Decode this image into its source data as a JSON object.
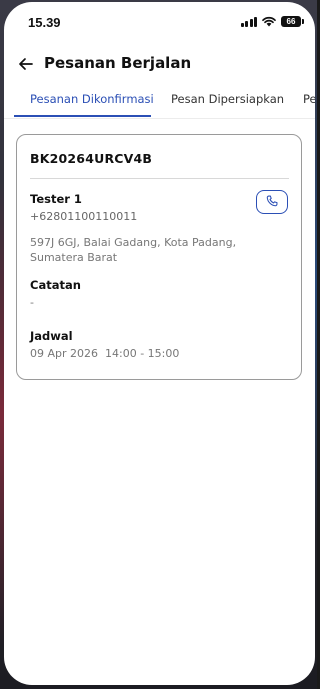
{
  "status_bar": {
    "time": "15.39",
    "battery": "66",
    "icons": [
      "signal-icon",
      "wifi-icon",
      "battery-icon"
    ]
  },
  "header": {
    "back_icon": "arrow-left-icon",
    "title": "Pesanan Berjalan"
  },
  "tabs": [
    {
      "label": "Pesanan Dikonfirmasi",
      "active": true
    },
    {
      "label": "Pesan Dipersiapkan",
      "active": false
    },
    {
      "label": "Pe",
      "active": false
    }
  ],
  "order": {
    "code": "BK20264URCV4B",
    "customer_name": "Tester 1",
    "phone": "+62801100110011",
    "address": "597J 6GJ, Balai Gadang, Kota Padang, Sumatera Barat",
    "call_icon": "phone-icon",
    "note_label": "Catatan",
    "note_value": "-",
    "schedule_label": "Jadwal",
    "schedule_value": "09 Apr 2026  14:00 - 15:00"
  },
  "colors": {
    "accent": "#2b4fb5",
    "text_primary": "#111111",
    "text_secondary": "#777777",
    "card_border": "#9a9a9a"
  }
}
